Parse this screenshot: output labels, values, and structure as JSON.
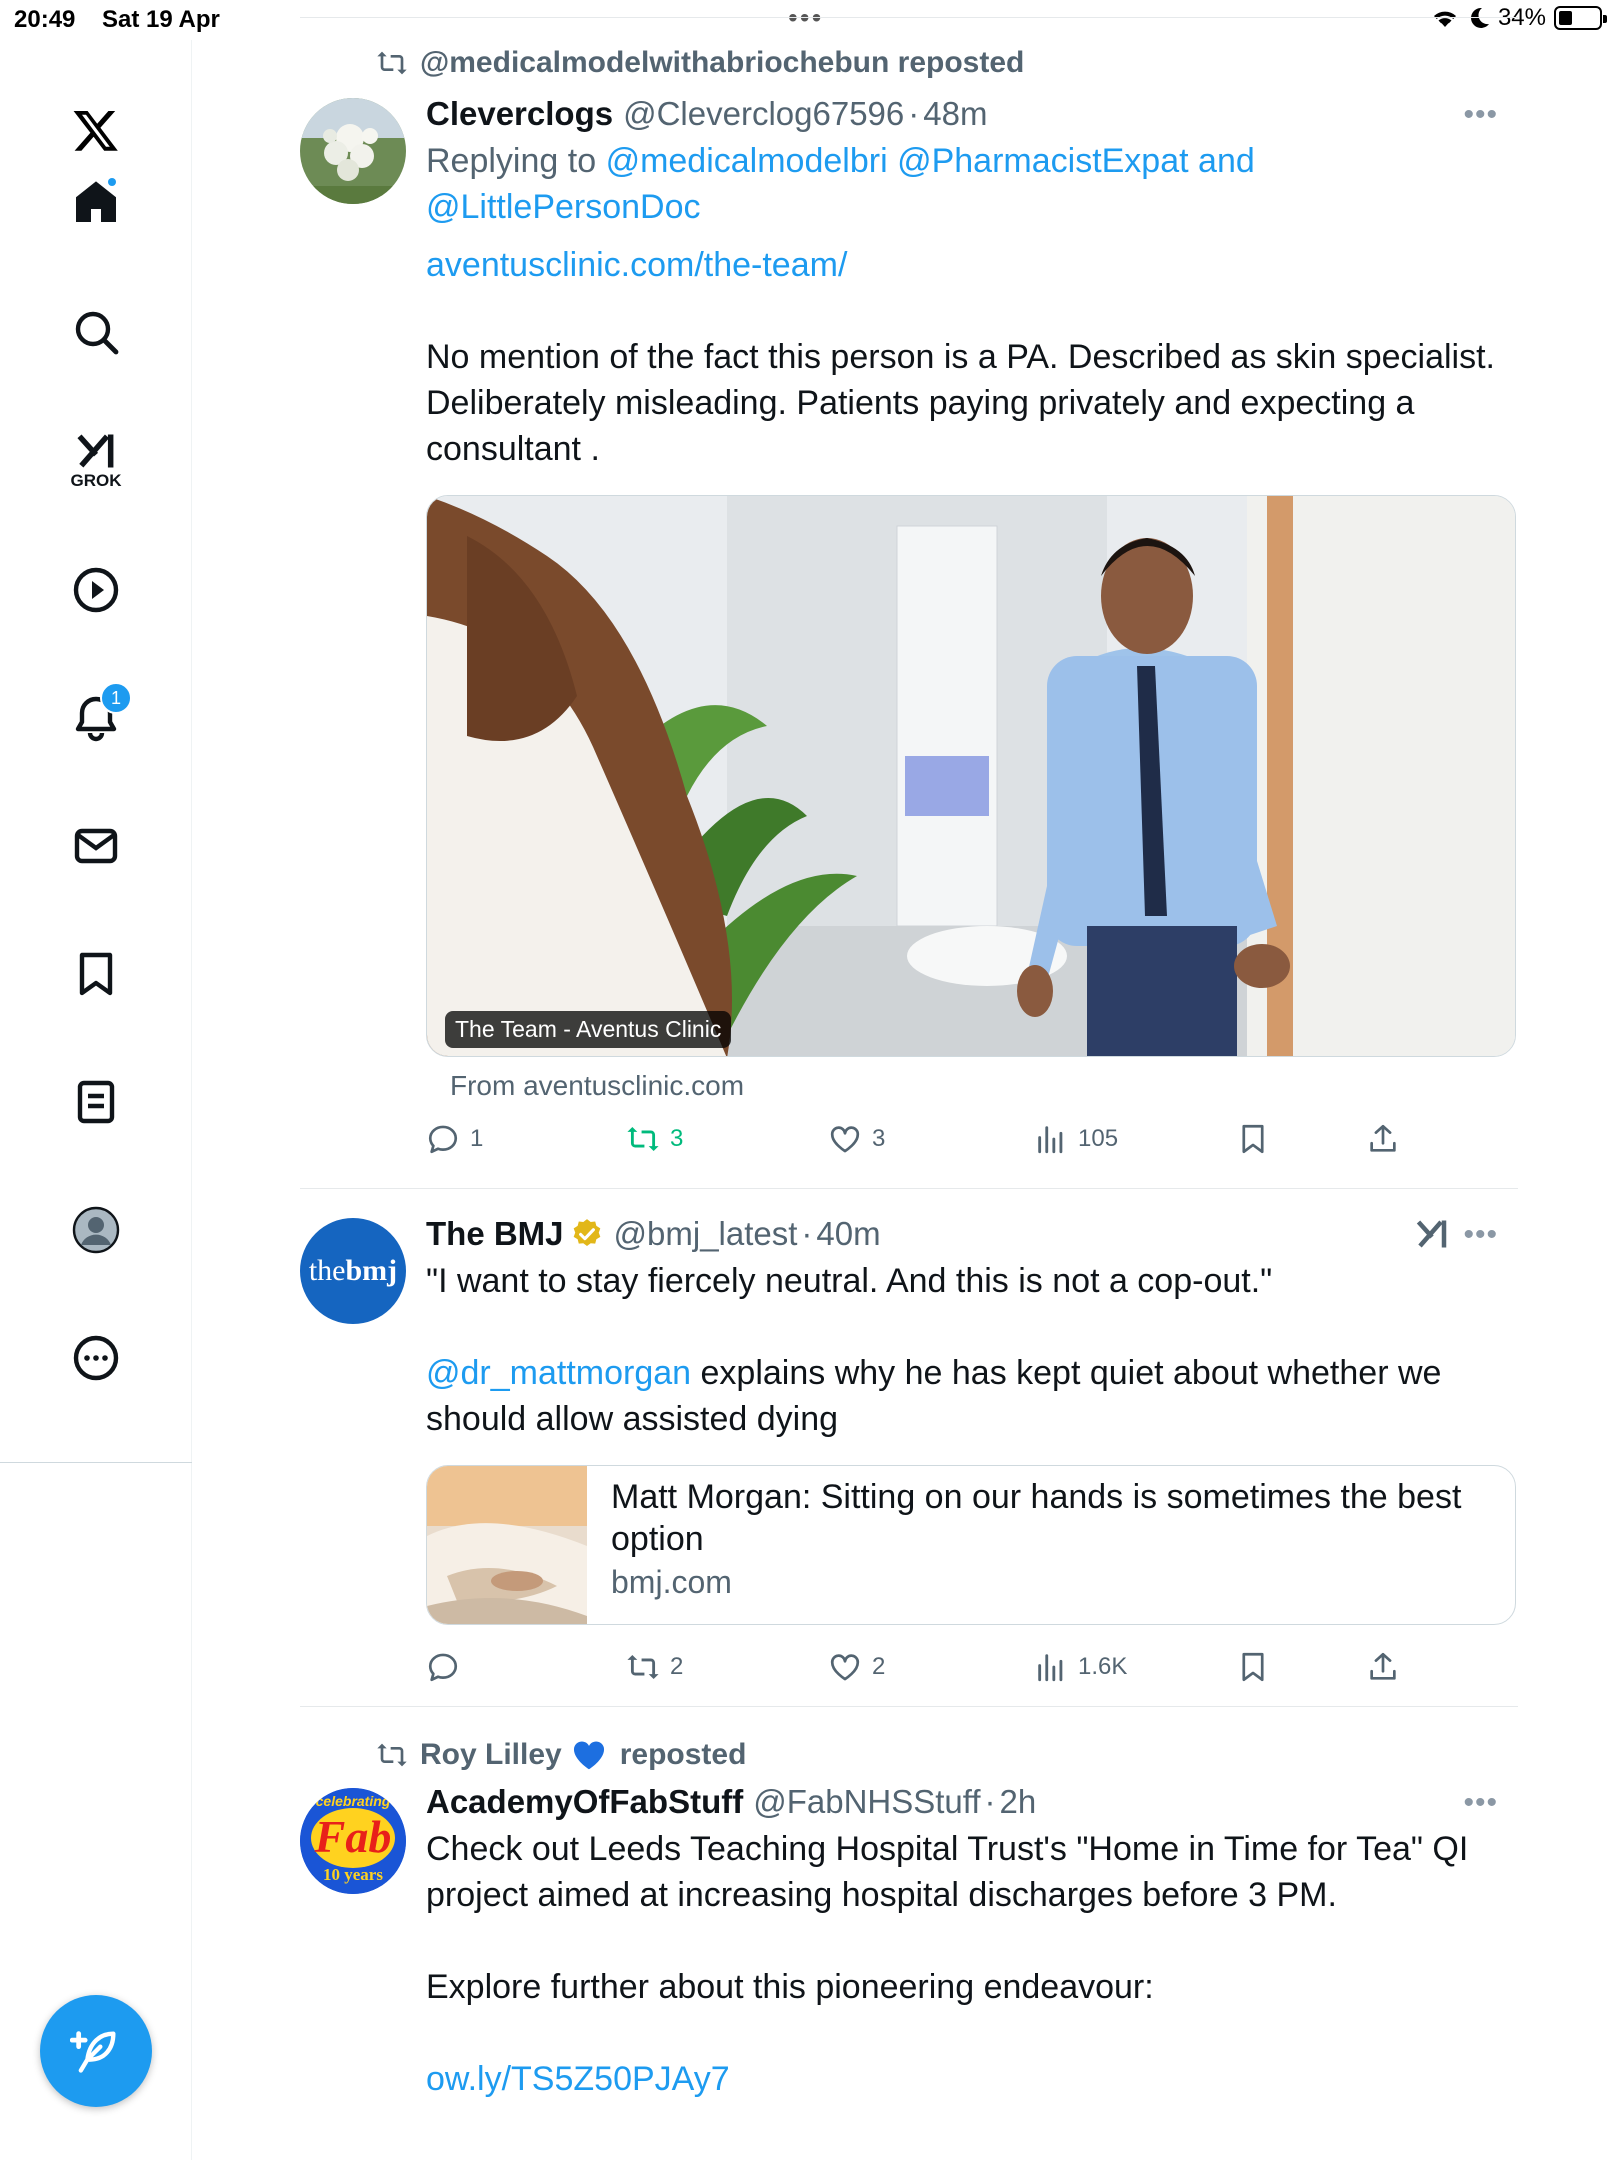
{
  "status": {
    "time": "20:49",
    "date": "Sat 19 Apr",
    "battery": "34%",
    "battery_level": 0.34
  },
  "sidebar": {
    "items": [
      {
        "name": "x-logo"
      },
      {
        "name": "home"
      },
      {
        "name": "search"
      },
      {
        "name": "grok",
        "label": "GROK"
      },
      {
        "name": "video"
      },
      {
        "name": "notifications",
        "badge": "1"
      },
      {
        "name": "messages"
      },
      {
        "name": "bookmarks"
      },
      {
        "name": "lists"
      },
      {
        "name": "profile"
      },
      {
        "name": "more"
      }
    ]
  },
  "tweets": [
    {
      "repost_by": "@medicalmodelwithabriochebun reposted",
      "name": "Cleverclogs",
      "handle": "@Cleverclog67596",
      "time": "48m",
      "replying_prefix": "Replying to",
      "replying_to": "@medicalmodelbri @PharmacistExpat",
      "replying_and": "and",
      "replying_last": "@LittlePersonDoc",
      "link": "aventusclinic.com/the-team/",
      "text_lines": [
        "No mention of the fact this person is a PA. Described as skin specialist.",
        "Deliberately misleading. Patients paying privately and expecting a",
        "consultant ."
      ],
      "card_caption": "The Team - Aventus Clinic",
      "card_from": "From aventusclinic.com",
      "replies": "1",
      "reposts": "3",
      "likes": "3",
      "views": "105"
    },
    {
      "name": "The BMJ",
      "handle": "@bmj_latest",
      "time": "40m",
      "avatar_text_a": "the",
      "avatar_text_b": "bmj",
      "text_line1": "\"I want to stay fiercely neutral. And this is not a cop-out.\"",
      "mention": "@dr_mattmorgan",
      "text_line2a": " explains why he has kept quiet about whether we",
      "text_line2b": "should allow assisted dying",
      "card_title": "Matt Morgan: Sitting on our hands is sometimes the best option",
      "card_domain": "bmj.com",
      "reposts": "2",
      "likes": "2",
      "views": "1.6K"
    },
    {
      "repost_by": "Roy Lilley",
      "repost_suffix": "reposted",
      "name": "AcademyOfFabStuff",
      "handle": "@FabNHSStuff",
      "time": "2h",
      "avatar_top": "celebrating",
      "avatar_mid": "Fab",
      "avatar_bottom": "10 years",
      "text_lines": [
        "Check out Leeds Teaching Hospital Trust's \"Home in Time for Tea\" QI",
        "project aimed at increasing hospital discharges before 3 PM."
      ],
      "text_line3": "Explore further about this pioneering endeavour:",
      "link": "ow.ly/TS5Z50PJAy7"
    }
  ],
  "colors": {
    "accent": "#1d9bf0",
    "repost_green": "#00ba7c",
    "secondary_text": "#536471"
  }
}
